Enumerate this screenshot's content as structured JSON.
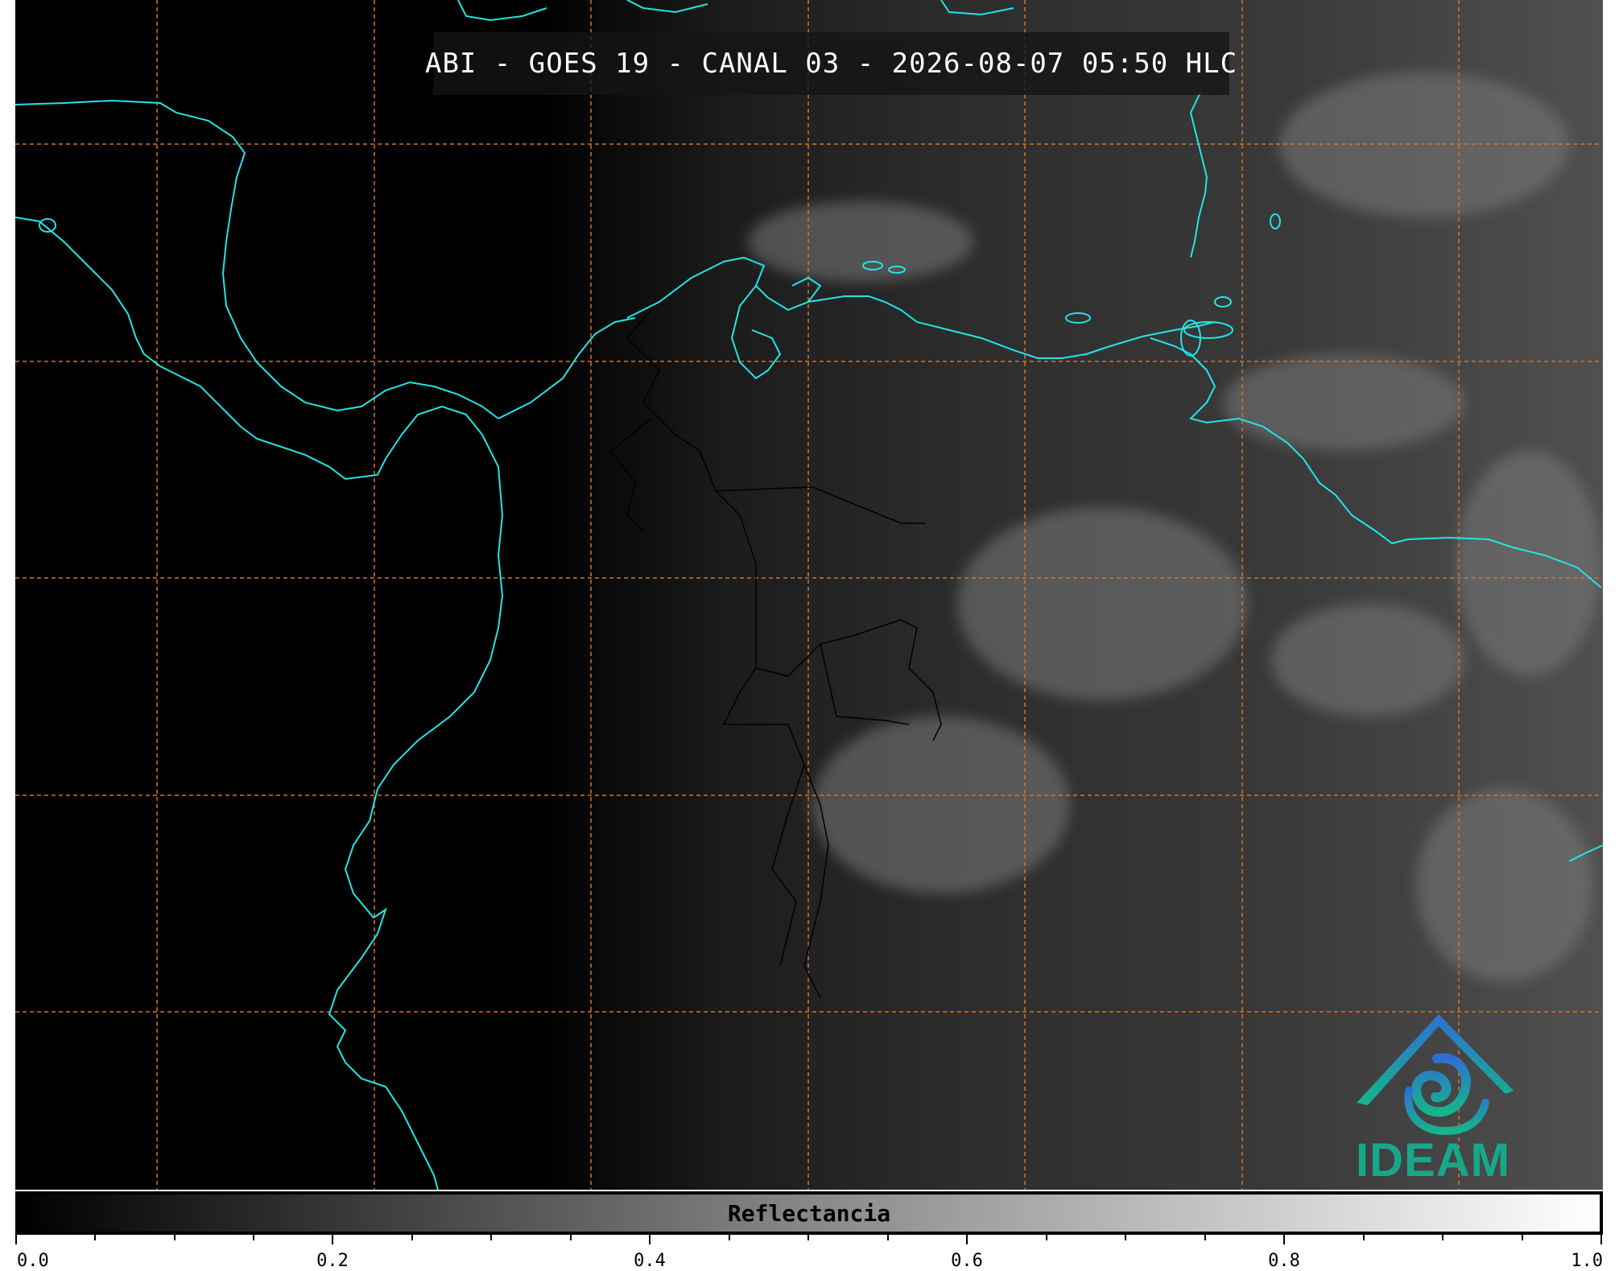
{
  "title": "ABI - GOES 19 - CANAL 03 - 2026-08-07 05:50 HLC",
  "colors": {
    "coastline": "#22e5e5",
    "grid": "#d0762a",
    "borders": "#000000"
  },
  "colorbar": {
    "label": "Reflectancia",
    "range": [
      0.0,
      1.0
    ],
    "tick_labels": [
      "0.0",
      "0.2",
      "0.4",
      "0.6",
      "0.8",
      "1.0"
    ]
  },
  "logo": {
    "text": "IDEAM"
  }
}
